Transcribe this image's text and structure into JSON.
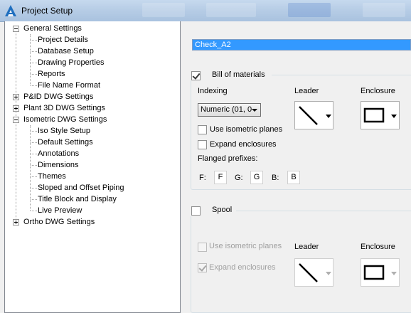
{
  "window": {
    "title": "Project Setup"
  },
  "tree": {
    "items": [
      {
        "label": "General Settings",
        "expander": "minus"
      },
      {
        "label": "Project Details"
      },
      {
        "label": "Database Setup"
      },
      {
        "label": "Drawing Properties"
      },
      {
        "label": "Reports"
      },
      {
        "label": "File Name Format"
      },
      {
        "label": "P&ID DWG Settings",
        "expander": "plus"
      },
      {
        "label": "Plant 3D DWG Settings",
        "expander": "plus"
      },
      {
        "label": "Isometric DWG Settings",
        "expander": "minus"
      },
      {
        "label": "Iso Style Setup"
      },
      {
        "label": "Default Settings"
      },
      {
        "label": "Annotations"
      },
      {
        "label": "Dimensions"
      },
      {
        "label": "Themes"
      },
      {
        "label": "Sloped and Offset Piping"
      },
      {
        "label": "Title Block and Display"
      },
      {
        "label": "Live Preview"
      },
      {
        "label": "Ortho DWG Settings",
        "expander": "plus"
      }
    ]
  },
  "form": {
    "name_value": "Check_A2",
    "bom": {
      "label": "Bill of materials",
      "checked": true,
      "indexing_label": "Indexing",
      "indexing_value": "Numeric (01, 0",
      "leader_label": "Leader",
      "leader_icon": "diagonal-line-icon",
      "enclosure_label": "Enclosure",
      "enclosure_icon": "rectangle-icon",
      "use_iso_planes": {
        "label": "Use isometric planes",
        "checked": false
      },
      "expand_enclosures": {
        "label": "Expand enclosures",
        "checked": false
      },
      "flanged_prefixes_label": "Flanged prefixes:",
      "prefixes": [
        {
          "label": "F:",
          "value": "F"
        },
        {
          "label": "G:",
          "value": "G"
        },
        {
          "label": "B:",
          "value": "B"
        }
      ]
    },
    "spool": {
      "label": "Spool",
      "checked": false,
      "use_iso_planes": {
        "label": "Use isometric planes",
        "checked": false,
        "disabled": true
      },
      "expand_enclosures": {
        "label": "Expand enclosures",
        "checked": true,
        "disabled": true
      },
      "leader_label": "Leader",
      "enclosure_label": "Enclosure"
    }
  },
  "colors": {
    "selection": "#3399ff",
    "titlebar": "#b7cde6"
  }
}
